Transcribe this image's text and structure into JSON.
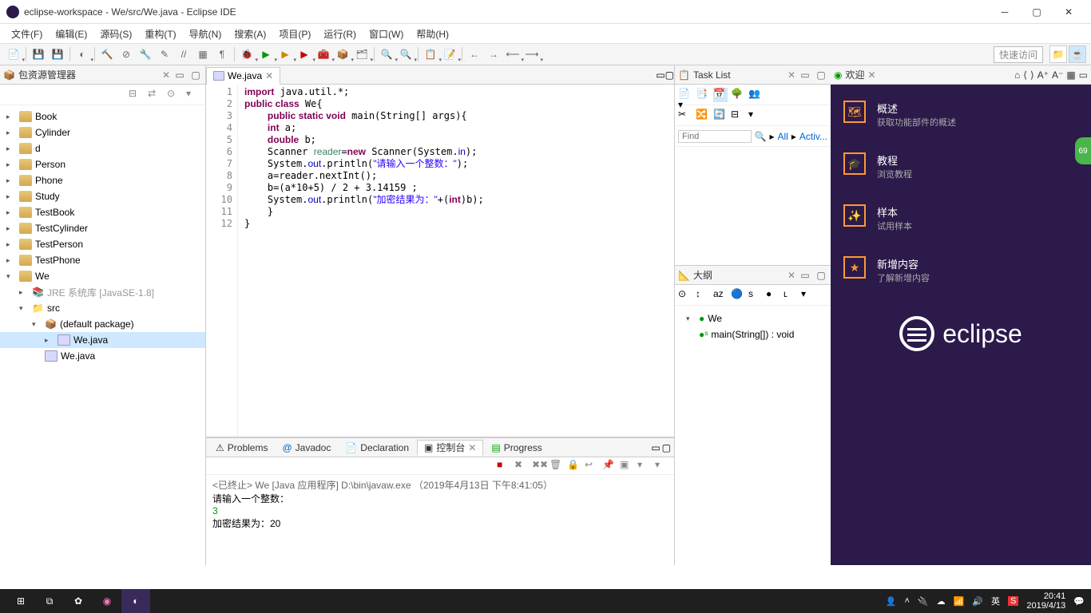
{
  "window_title": "eclipse-workspace - We/src/We.java - Eclipse IDE",
  "menubar": [
    "文件(F)",
    "编辑(E)",
    "源码(S)",
    "重构(T)",
    "导航(N)",
    "搜索(A)",
    "项目(P)",
    "运行(R)",
    "窗口(W)",
    "帮助(H)"
  ],
  "quick_access": "快速访问",
  "package_explorer": {
    "title": "包资源管理器",
    "projects": [
      "Book",
      "Cylinder",
      "d",
      "Person",
      "Phone",
      "Study",
      "TestBook",
      "TestCylinder",
      "TestPerson",
      "TestPhone"
    ],
    "open_project": "We",
    "jre": "JRE 系统库 [JavaSE-1.8]",
    "src": "src",
    "pkg": "(default package)",
    "file_sel": "We.java",
    "file2": "We.java"
  },
  "editor": {
    "tab": "We.java",
    "lines": [
      "1",
      "2",
      "3",
      "4",
      "5",
      "6",
      "7",
      "8",
      "9",
      "10",
      "11",
      "12"
    ],
    "code_html": "<span class='kw'>import</span> java.util.*;\n<span class='kw'>public class</span> We{\n    <span class='kw'>public static void</span> main(String[] args){\n    <span class='kw'>int</span> a;\n    <span class='kw'>double</span> b;\n    Scanner <span class='cmt'>reader</span>=<span class='kw'>new</span> Scanner(System.<span class='fld'>in</span>);\n    System.<span class='fld'>out</span>.println(<span class='str'>\"请输入一个整数：\"</span>);\n    a=reader.nextInt();\n    b=(a*10+5) / 2 + 3.14159 ;\n    System.<span class='fld'>out</span>.println(<span class='str'>\"加密结果为：\"</span>+(<span class='kw'>int</span>)b);\n    }\n}"
  },
  "bottom_tabs": [
    "Problems",
    "Javadoc",
    "Declaration",
    "控制台",
    "Progress"
  ],
  "console": {
    "header": "<已终止> We [Java 应用程序] D:\\bin\\javaw.exe （2019年4月13日 下午8:41:05）",
    "lines": [
      "请输入一个整数：",
      "3",
      "加密结果为：20"
    ]
  },
  "task_list": {
    "title": "Task List",
    "find": "Find",
    "all": "All",
    "activ": "Activ..."
  },
  "outline": {
    "title": "大纲",
    "class": "We",
    "method": "main(String[]) : void"
  },
  "welcome": {
    "tab": "欢迎",
    "items": [
      {
        "t1": "概述",
        "t2": "获取功能部件的概述"
      },
      {
        "t1": "教程",
        "t2": "浏览教程"
      },
      {
        "t1": "样本",
        "t2": "试用样本"
      },
      {
        "t1": "新增内容",
        "t2": "了解新增内容"
      }
    ],
    "logo": "eclipse"
  },
  "badge": "69",
  "taskbar": {
    "time": "20:41",
    "date": "2019/4/13",
    "ime": "英"
  }
}
